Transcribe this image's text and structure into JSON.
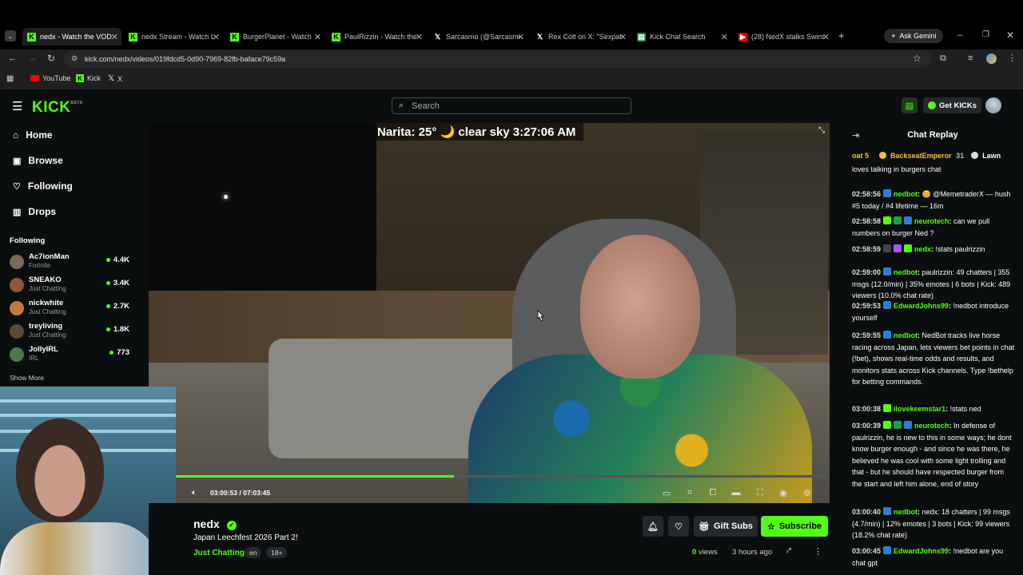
{
  "browser": {
    "tabs": [
      {
        "label": "nedx - Watch the VOD",
        "favicon": "kick-icon",
        "active": true
      },
      {
        "label": "nedx Stream - Watch L",
        "favicon": "kick-icon",
        "active": false
      },
      {
        "label": "BurgerPlanet - Watch",
        "favicon": "kick-icon",
        "active": false
      },
      {
        "label": "PaulRizzin - Watch the",
        "favicon": "kick-icon",
        "active": false
      },
      {
        "label": "Sarcasmo (@Sarcasmo",
        "favicon": "x-icon",
        "active": false
      },
      {
        "label": "Rex Colt on X: \"Sexpat",
        "favicon": "x-icon",
        "active": false
      },
      {
        "label": "Kick Chat Search",
        "favicon": "chat-search-icon",
        "active": false
      },
      {
        "label": "(28) NedX stalks Swim",
        "favicon": "youtube-icon",
        "active": false
      }
    ],
    "ask_gemini": "Ask Gemini",
    "url": "kick.com/nedx/videos/019fdcd5-0d90-7969-82fb-baface79c59a",
    "bookmarks": [
      {
        "label": "YouTube",
        "icon": "youtube-icon"
      },
      {
        "label": "Kick",
        "icon": "kick-icon"
      },
      {
        "label": "X",
        "icon": "x-icon"
      }
    ]
  },
  "header": {
    "logo": "KICK",
    "logo_sup": "BETA",
    "search_placeholder": "Search",
    "get_kicks": "Get KICKs"
  },
  "sidebar": {
    "nav": [
      {
        "label": "Home",
        "icon": "home-icon"
      },
      {
        "label": "Browse",
        "icon": "browse-icon"
      },
      {
        "label": "Following",
        "icon": "heart-icon"
      },
      {
        "label": "Drops",
        "icon": "drops-icon"
      }
    ],
    "following_heading": "Following",
    "following": [
      {
        "name": "Ac7ionMan",
        "category": "Fortnite",
        "viewers": "4.4K",
        "color": "#7a6a5a"
      },
      {
        "name": "SNEAKO",
        "category": "Just Chatting",
        "viewers": "3.4K",
        "color": "#8a5a3a"
      },
      {
        "name": "nickwhite",
        "category": "Just Chatting",
        "viewers": "2.7K",
        "color": "#c07a40"
      },
      {
        "name": "treyliving",
        "category": "Just Chatting",
        "viewers": "1.8K",
        "color": "#5a4a3a"
      },
      {
        "name": "JollyIRL",
        "category": "IRL",
        "viewers": "773",
        "color": "#4a7a4a"
      }
    ],
    "show_more": "Show More"
  },
  "video": {
    "overlay": "Narita: 25° 🌙 clear sky 3:27:06 AM",
    "time": "03:00:53 / 07:03:45",
    "progress": 0.4255
  },
  "stream": {
    "name": "nedx",
    "title": "Japan Leechfest 2026 Part 2!",
    "category": "Just Chatting",
    "tags": [
      "en",
      "18+"
    ],
    "views_count": "0",
    "views_label": "views",
    "ago": "3 hours ago",
    "gift_subs": "Gift Subs",
    "subscribe": "Subscribe"
  },
  "chat": {
    "title": "Chat Replay",
    "top_banner": {
      "left": "oat 5",
      "user": "BackseatEmperor",
      "count": "31",
      "right": "Lawn"
    },
    "partial_first": "loves talking in burgers chat",
    "messages": [
      {
        "ts": "02:58:56",
        "user": "nedbot",
        "color": "#53fc18",
        "badges": [
          "#2a7fd4"
        ],
        "text": "😊 @MemetraderX — hush #5 today / #4 lifetime — 16m"
      },
      {
        "ts": "02:58:58",
        "user": "neurotech",
        "color": "#53fc18",
        "badges": [
          "#53fc18",
          "#16a34a",
          "#2a7fd4"
        ],
        "text": "can we pull numbers on burger Ned ?"
      },
      {
        "ts": "02:58:59",
        "user": "nedx",
        "color": "#53fc18",
        "badges": [
          "#444",
          "#a855f7",
          "#53fc18"
        ],
        "text": "!stats paulrizzin"
      },
      {
        "ts": "02:59:00",
        "user": "nedbot",
        "color": "#53fc18",
        "badges": [
          "#2a7fd4"
        ],
        "text": "paulrizzin: 49 chatters | 355 msgs (12.0/min) | 35% emotes | 6 bots | Kick: 489 viewers (10.0% chat rate)"
      },
      {
        "ts": "02:59:53",
        "user": "EdwardJohns99",
        "color": "#53fc18",
        "badges": [
          "#2a7fd4"
        ],
        "text": "!nedbot introduce yourself"
      },
      {
        "ts": "02:59:55",
        "user": "nedbot",
        "color": "#53fc18",
        "badges": [
          "#2a7fd4"
        ],
        "text": "NedBot tracks live horse racing across Japan, lets viewers bet points in chat (!bet), shows real-time odds and results, and monitors stats across Kick channels. Type !bethelp for betting commands."
      },
      {
        "ts": "03:00:38",
        "user": "ilovekeemstar1",
        "color": "#53fc18",
        "badges": [
          "#53fc18"
        ],
        "text": "!stats ned"
      },
      {
        "ts": "03:00:39",
        "user": "neurotech",
        "color": "#53fc18",
        "badges": [
          "#53fc18",
          "#16a34a",
          "#2a7fd4"
        ],
        "text": "In defense of paulrizzin, he is new to this in some ways; he dont know burger enough - and since he was there, he believed he was cool with some light trolling and that - but he should have respected burger from the start and left him alone, end of story"
      },
      {
        "ts": "03:00:40",
        "user": "nedbot",
        "color": "#53fc18",
        "badges": [
          "#2a7fd4"
        ],
        "text": "nedx: 18 chatters | 99 msgs (4.7/min) | 12% emotes | 3 bots | Kick: 99 viewers (18.2% chat rate)"
      },
      {
        "ts": "03:00:45",
        "user": "EdwardJohns99",
        "color": "#53fc18",
        "badges": [
          "#2a7fd4"
        ],
        "text": "!nedbot are you chat gpt"
      }
    ]
  },
  "colors": {
    "accent": "#53fc18",
    "bg": "#0b0e0f"
  }
}
